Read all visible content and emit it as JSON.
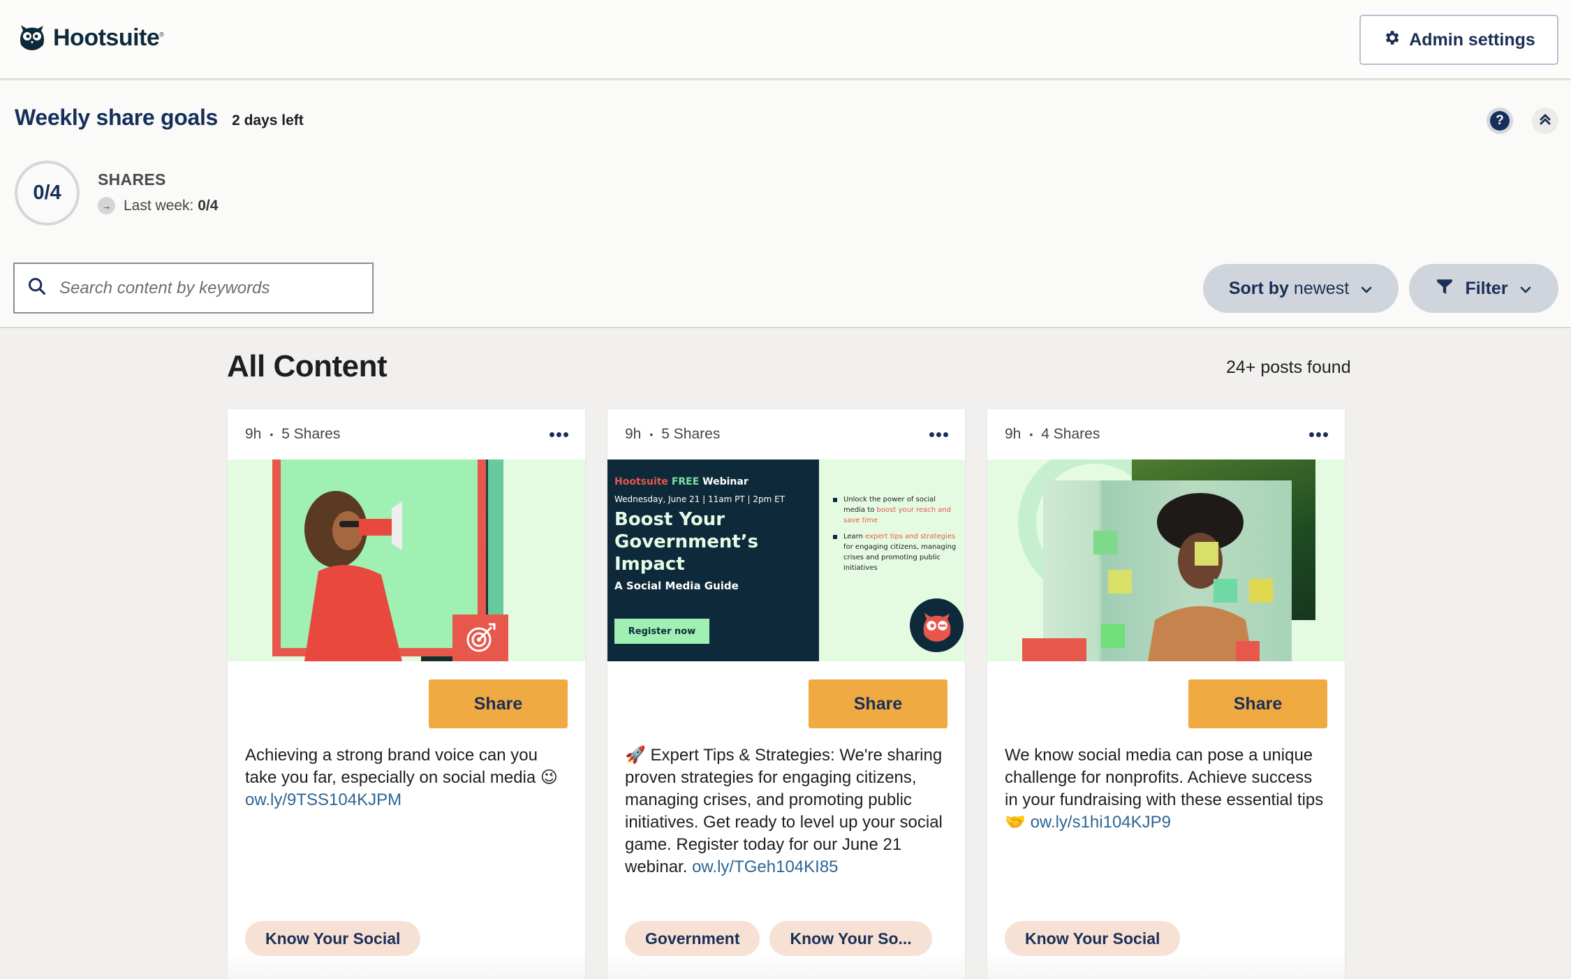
{
  "header": {
    "logo_text": "Hootsuite",
    "logo_mark": "®",
    "admin_button_label": "Admin settings"
  },
  "goals": {
    "title": "Weekly share goals",
    "days_left": "2 days left",
    "progress_label": "0/4",
    "progress_fraction": 0,
    "shares_label": "SHARES",
    "last_week_label": "Last week:",
    "last_week_value": "0/4",
    "help_icon": "question-icon",
    "collapse_icon": "double-chevron-up-icon"
  },
  "toolbar": {
    "search_placeholder": "Search content by keywords",
    "search_value": "",
    "sort_prefix": "Sort by",
    "sort_value": "newest",
    "filter_label": "Filter"
  },
  "main": {
    "title": "All Content",
    "posts_found": "24+ posts found",
    "cards": [
      {
        "age": "9h",
        "shares": "5 Shares",
        "share_label": "Share",
        "text": "Achieving a strong brand voice can you take you far, especially on social media 😉 ",
        "link": "ow.ly/9TSS104KJPM",
        "tags": [
          "Know Your Social"
        ],
        "image_alt": "Woman shouting into megaphone with target icon"
      },
      {
        "age": "9h",
        "shares": "5 Shares",
        "share_label": "Share",
        "text": "🚀 Expert Tips & Strategies: We're sharing proven strategies for engaging citizens, managing crises, and promoting public initiatives. Get ready to level up your social game. Register today for our June 21 webinar.  ",
        "link": "ow.ly/TGeh104KI85",
        "tags": [
          "Government",
          "Know Your So..."
        ],
        "image": {
          "brand": "Hootsuite",
          "free": "FREE",
          "webinar": "Webinar",
          "date": "Wednesday, June 21 | 11am PT | 2pm ET",
          "headline": "Boost Your Government’s Impact",
          "subhead": "A Social Media Guide",
          "cta": "Register now",
          "bullet1_a": "Unlock the power of social media to ",
          "bullet1_b": "boost your reach and save time",
          "bullet2_a": "Learn ",
          "bullet2_b": "expert tips and strategies",
          "bullet2_c": " for engaging citizens, managing crises and promoting public initiatives"
        }
      },
      {
        "age": "9h",
        "shares": "4 Shares",
        "share_label": "Share",
        "text": "We know social media can pose a unique challenge for nonprofits. Achieve success in your fundraising with these essential tips 🤝 ",
        "link": "ow.ly/s1hi104KJP9",
        "tags": [
          "Know Your Social"
        ],
        "image_alt": "Woman thinking behind glass with sticky notes"
      }
    ]
  },
  "colors": {
    "brand_navy": "#1a2f56",
    "share_orange": "#f0aa42",
    "tag_peach": "#f7e1d4",
    "link_blue": "#2d6595",
    "hootsuite_red": "#e8574c",
    "mint": "#a0f0b4",
    "dark_teal": "#0e2a3a"
  }
}
